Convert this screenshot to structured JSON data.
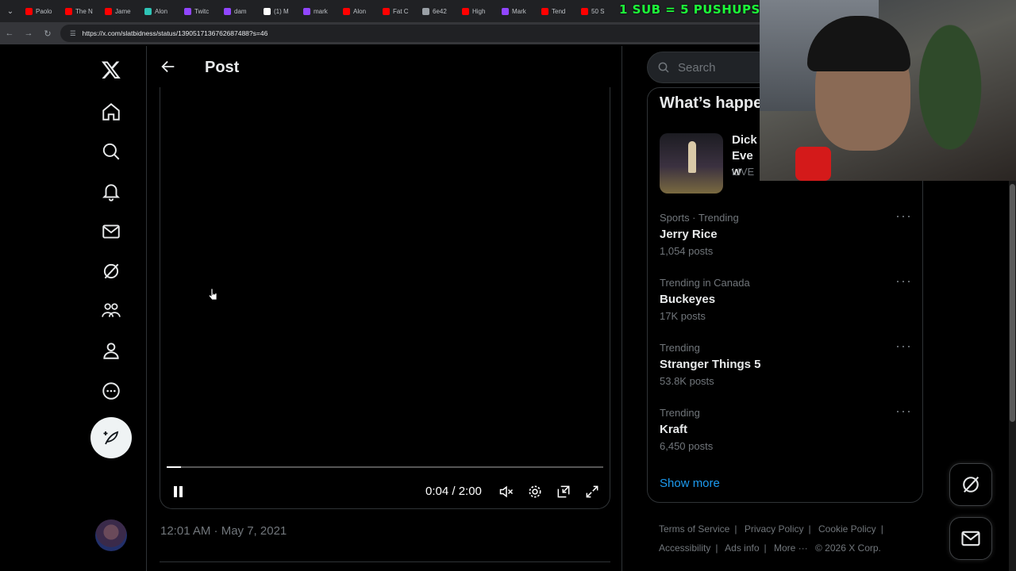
{
  "browser": {
    "tabs": [
      "Paolo",
      "The N",
      "Jame",
      "Alon",
      "Twitc",
      "dam",
      "(1) M",
      "mark",
      "Alon",
      "Fat C",
      "6e42",
      "High",
      "Mark",
      "Tend",
      "50 S"
    ],
    "tab_colors": [
      "#ff0000",
      "#ff0000",
      "#ff0000",
      "#2ec4b6",
      "#9146ff",
      "#9146ff",
      "#ffffff",
      "#9146ff",
      "#ff0000",
      "#ff0000",
      "#9aa0a6",
      "#ff0000",
      "#9146ff",
      "#ff0000",
      "#ff0000"
    ],
    "url": "https://x.com/slatbidness/status/1390517136762687488?s=46",
    "banner": "1 SUB = 5 PUSHUPS"
  },
  "header": {
    "title": "Post"
  },
  "video": {
    "timecode": "0:04 / 2:00",
    "progress": 0.033
  },
  "post": {
    "timestamp": "12:01 AM · May 7, 2021"
  },
  "search": {
    "placeholder": "Search"
  },
  "trends": {
    "title": "What’s happe",
    "live": {
      "title": "Dick Eve w",
      "tag": "LIVE"
    },
    "items": [
      {
        "meta": "Sports · Trending",
        "name": "Jerry Rice",
        "count": "1,054 posts"
      },
      {
        "meta": "Trending in Canada",
        "name": "Buckeyes",
        "count": "17K posts"
      },
      {
        "meta": "Trending",
        "name": "Stranger Things 5",
        "count": "53.8K posts"
      },
      {
        "meta": "Trending",
        "name": "Kraft",
        "count": "6,450 posts"
      }
    ],
    "show_more": "Show more"
  },
  "footer": {
    "terms": "Terms of Service",
    "privacy": "Privacy Policy",
    "cookie": "Cookie Policy",
    "accessibility": "Accessibility",
    "ads": "Ads info",
    "more": "More ···",
    "copyright": "© 2026 X Corp."
  }
}
